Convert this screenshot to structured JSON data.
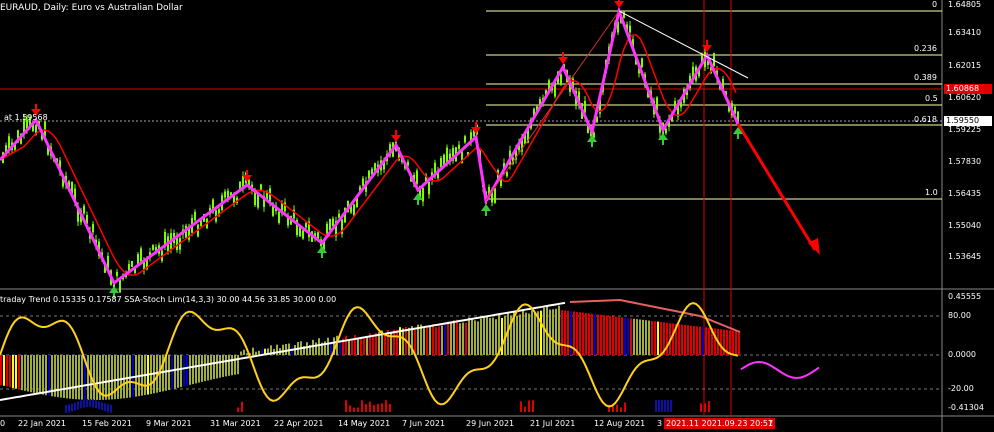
{
  "header": {
    "symbol_title": "EURAUD, Daily:  Euro vs Australian Dollar",
    "level_label": "at 1.59568"
  },
  "indicator": {
    "title": "traday Trend  0.15335 0.17587 SSA-Stoch Lim(14,3,3) 30.00 44.56 33.85 30.00 0.00"
  },
  "price_axis": {
    "labels": [
      "1.64805",
      "1.63410",
      "1.62015",
      "1.60620",
      "1.59225",
      "1.57830",
      "1.56435",
      "1.55040",
      "1.53645"
    ],
    "current_price": "1.60868",
    "level_price": "1.59550"
  },
  "indicator_axis": {
    "labels": [
      "0.45555",
      "80.00",
      "0.0000",
      "-20.00",
      "-0.41304"
    ]
  },
  "fibonacci": {
    "levels": [
      "0",
      "0.236",
      "0.389",
      "0.5",
      "0.618",
      "1.0"
    ]
  },
  "time_axis": {
    "labels": [
      "0",
      "22 Jan 2021",
      "15 Feb 2021",
      "9 Mar 2021",
      "31 Mar 2021",
      "22 Apr 2021",
      "14 May 2021",
      "7 Jun 2021",
      "29 Jun 2021",
      "21 Jul 2021",
      "12 Aug 2021",
      "3"
    ],
    "cursor_label": "2021.11 2021.09.23 20:57",
    "cursor_suffix": "1"
  },
  "colors": {
    "background": "#000000",
    "bull_candle": "#7cfc00",
    "zigzag": "#ff33ff",
    "ma": "#ff0000",
    "fibo": "#ffff66",
    "signal_arrow": "#ff0000",
    "up_arrow": "#33cc33",
    "stoch_main": "#ffd11a",
    "stoch_signal": "#ff33ff",
    "hist_olive": "#a0ad3c",
    "hist_red": "#e00000",
    "hist_blue": "#0000c0"
  }
}
